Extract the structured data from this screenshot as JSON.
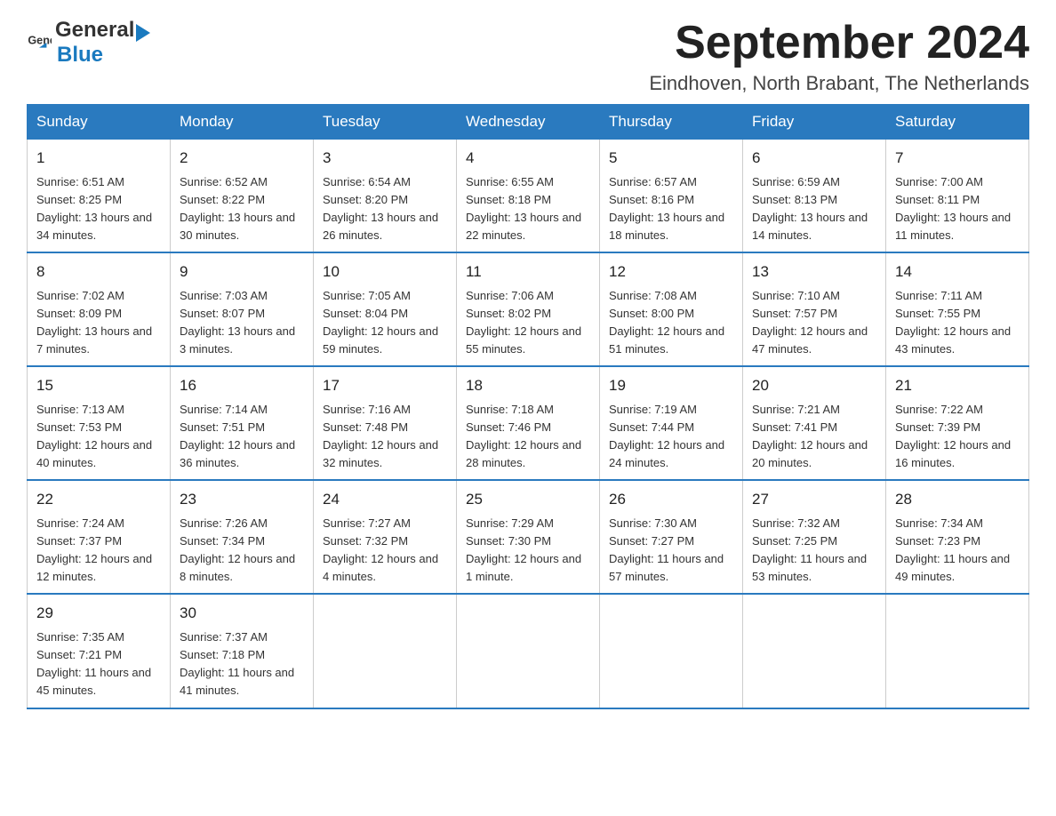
{
  "logo": {
    "text_general": "General",
    "text_blue": "Blue"
  },
  "title": "September 2024",
  "location": "Eindhoven, North Brabant, The Netherlands",
  "days_of_week": [
    "Sunday",
    "Monday",
    "Tuesday",
    "Wednesday",
    "Thursday",
    "Friday",
    "Saturday"
  ],
  "weeks": [
    [
      {
        "day": "1",
        "sunrise": "6:51 AM",
        "sunset": "8:25 PM",
        "daylight": "13 hours and 34 minutes."
      },
      {
        "day": "2",
        "sunrise": "6:52 AM",
        "sunset": "8:22 PM",
        "daylight": "13 hours and 30 minutes."
      },
      {
        "day": "3",
        "sunrise": "6:54 AM",
        "sunset": "8:20 PM",
        "daylight": "13 hours and 26 minutes."
      },
      {
        "day": "4",
        "sunrise": "6:55 AM",
        "sunset": "8:18 PM",
        "daylight": "13 hours and 22 minutes."
      },
      {
        "day": "5",
        "sunrise": "6:57 AM",
        "sunset": "8:16 PM",
        "daylight": "13 hours and 18 minutes."
      },
      {
        "day": "6",
        "sunrise": "6:59 AM",
        "sunset": "8:13 PM",
        "daylight": "13 hours and 14 minutes."
      },
      {
        "day": "7",
        "sunrise": "7:00 AM",
        "sunset": "8:11 PM",
        "daylight": "13 hours and 11 minutes."
      }
    ],
    [
      {
        "day": "8",
        "sunrise": "7:02 AM",
        "sunset": "8:09 PM",
        "daylight": "13 hours and 7 minutes."
      },
      {
        "day": "9",
        "sunrise": "7:03 AM",
        "sunset": "8:07 PM",
        "daylight": "13 hours and 3 minutes."
      },
      {
        "day": "10",
        "sunrise": "7:05 AM",
        "sunset": "8:04 PM",
        "daylight": "12 hours and 59 minutes."
      },
      {
        "day": "11",
        "sunrise": "7:06 AM",
        "sunset": "8:02 PM",
        "daylight": "12 hours and 55 minutes."
      },
      {
        "day": "12",
        "sunrise": "7:08 AM",
        "sunset": "8:00 PM",
        "daylight": "12 hours and 51 minutes."
      },
      {
        "day": "13",
        "sunrise": "7:10 AM",
        "sunset": "7:57 PM",
        "daylight": "12 hours and 47 minutes."
      },
      {
        "day": "14",
        "sunrise": "7:11 AM",
        "sunset": "7:55 PM",
        "daylight": "12 hours and 43 minutes."
      }
    ],
    [
      {
        "day": "15",
        "sunrise": "7:13 AM",
        "sunset": "7:53 PM",
        "daylight": "12 hours and 40 minutes."
      },
      {
        "day": "16",
        "sunrise": "7:14 AM",
        "sunset": "7:51 PM",
        "daylight": "12 hours and 36 minutes."
      },
      {
        "day": "17",
        "sunrise": "7:16 AM",
        "sunset": "7:48 PM",
        "daylight": "12 hours and 32 minutes."
      },
      {
        "day": "18",
        "sunrise": "7:18 AM",
        "sunset": "7:46 PM",
        "daylight": "12 hours and 28 minutes."
      },
      {
        "day": "19",
        "sunrise": "7:19 AM",
        "sunset": "7:44 PM",
        "daylight": "12 hours and 24 minutes."
      },
      {
        "day": "20",
        "sunrise": "7:21 AM",
        "sunset": "7:41 PM",
        "daylight": "12 hours and 20 minutes."
      },
      {
        "day": "21",
        "sunrise": "7:22 AM",
        "sunset": "7:39 PM",
        "daylight": "12 hours and 16 minutes."
      }
    ],
    [
      {
        "day": "22",
        "sunrise": "7:24 AM",
        "sunset": "7:37 PM",
        "daylight": "12 hours and 12 minutes."
      },
      {
        "day": "23",
        "sunrise": "7:26 AM",
        "sunset": "7:34 PM",
        "daylight": "12 hours and 8 minutes."
      },
      {
        "day": "24",
        "sunrise": "7:27 AM",
        "sunset": "7:32 PM",
        "daylight": "12 hours and 4 minutes."
      },
      {
        "day": "25",
        "sunrise": "7:29 AM",
        "sunset": "7:30 PM",
        "daylight": "12 hours and 1 minute."
      },
      {
        "day": "26",
        "sunrise": "7:30 AM",
        "sunset": "7:27 PM",
        "daylight": "11 hours and 57 minutes."
      },
      {
        "day": "27",
        "sunrise": "7:32 AM",
        "sunset": "7:25 PM",
        "daylight": "11 hours and 53 minutes."
      },
      {
        "day": "28",
        "sunrise": "7:34 AM",
        "sunset": "7:23 PM",
        "daylight": "11 hours and 49 minutes."
      }
    ],
    [
      {
        "day": "29",
        "sunrise": "7:35 AM",
        "sunset": "7:21 PM",
        "daylight": "11 hours and 45 minutes."
      },
      {
        "day": "30",
        "sunrise": "7:37 AM",
        "sunset": "7:18 PM",
        "daylight": "11 hours and 41 minutes."
      },
      null,
      null,
      null,
      null,
      null
    ]
  ]
}
